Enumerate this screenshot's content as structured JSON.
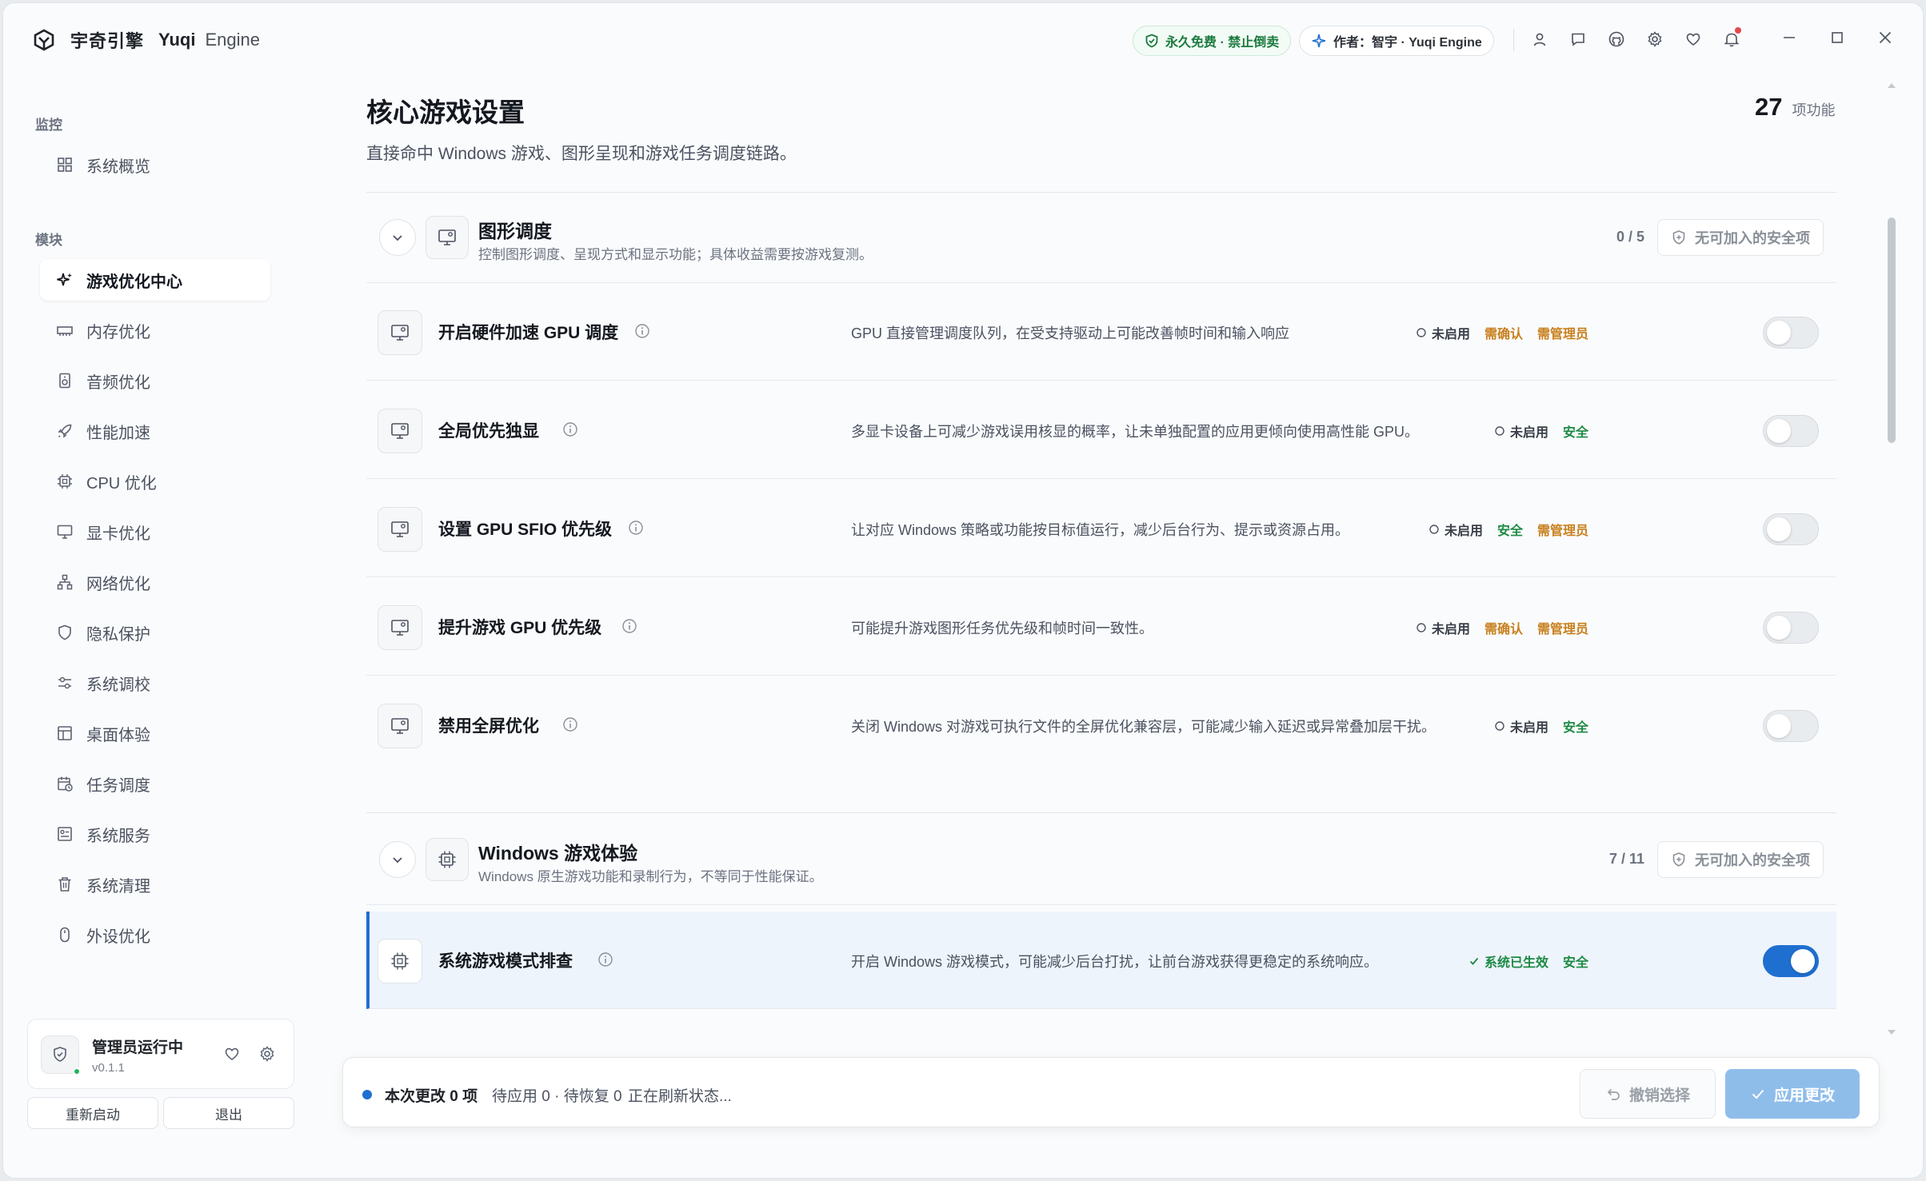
{
  "titlebar": {
    "brand_cn": "宇奇引擎",
    "brand_en": "Yuqi",
    "brand_en2": "Engine",
    "badge_free": "永久免费 · 禁止倒卖",
    "badge_author": "作者：智宇 · Yuqi Engine",
    "icons": [
      "user-icon",
      "chat-icon",
      "github-icon",
      "gear-icon",
      "heart-icon",
      "bell-icon"
    ],
    "window_controls": [
      "minimize-icon",
      "maximize-icon",
      "close-icon"
    ]
  },
  "sidebar": {
    "group_monitor": "监控",
    "group_modules": "模块",
    "items": [
      {
        "label": "系统概览",
        "icon": "grid-icon"
      },
      {
        "label": "游戏优化中心",
        "icon": "sparkle-icon",
        "active": true
      },
      {
        "label": "内存优化",
        "icon": "memory-icon"
      },
      {
        "label": "音频优化",
        "icon": "speaker-icon"
      },
      {
        "label": "性能加速",
        "icon": "rocket-icon"
      },
      {
        "label": "CPU 优化",
        "icon": "cpu-icon"
      },
      {
        "label": "显卡优化",
        "icon": "monitor-icon"
      },
      {
        "label": "网络优化",
        "icon": "network-icon"
      },
      {
        "label": "隐私保护",
        "icon": "shield-icon"
      },
      {
        "label": "系统调校",
        "icon": "sliders-icon"
      },
      {
        "label": "桌面体验",
        "icon": "layout-icon"
      },
      {
        "label": "任务调度",
        "icon": "calendar-clock-icon"
      },
      {
        "label": "系统服务",
        "icon": "services-icon"
      },
      {
        "label": "系统清理",
        "icon": "trash-icon"
      },
      {
        "label": "外设优化",
        "icon": "mouse-icon"
      }
    ],
    "admin": {
      "title": "管理员运行中",
      "version": "v0.1.1"
    },
    "restart_label": "重新启动",
    "exit_label": "退出"
  },
  "main": {
    "title": "核心游戏设置",
    "subtitle": "直接命中 Windows 游戏、图形呈现和游戏任务调度链路。",
    "count_num": "27",
    "count_label": "项功能",
    "sections": [
      {
        "title": "图形调度",
        "desc": "控制图形调度、呈现方式和显示功能；具体收益需要按游戏复测。",
        "count": "0 / 5",
        "safe_label": "无可加入的安全项",
        "rows": [
          {
            "title": "开启硬件加速 GPU 调度",
            "desc": "GPU 直接管理调度队列，在受支持驱动上可能改善帧时间和输入响应",
            "status": "未启用",
            "tags": [
              {
                "text": "需确认",
                "kind": "warn"
              },
              {
                "text": "需管理员",
                "kind": "warn"
              }
            ],
            "on": false
          },
          {
            "title": "全局优先独显",
            "desc": "多显卡设备上可减少游戏误用核显的概率，让未单独配置的应用更倾向使用高性能 GPU。",
            "status": "未启用",
            "tags": [
              {
                "text": "安全",
                "kind": "safe"
              }
            ],
            "on": false
          },
          {
            "title": "设置 GPU SFIO 优先级",
            "desc": "让对应 Windows 策略或功能按目标值运行，减少后台行为、提示或资源占用。",
            "status": "未启用",
            "tags": [
              {
                "text": "安全",
                "kind": "safe"
              },
              {
                "text": "需管理员",
                "kind": "warn"
              }
            ],
            "on": false
          },
          {
            "title": "提升游戏 GPU 优先级",
            "desc": "可能提升游戏图形任务优先级和帧时间一致性。",
            "status": "未启用",
            "tags": [
              {
                "text": "需确认",
                "kind": "warn"
              },
              {
                "text": "需管理员",
                "kind": "warn"
              }
            ],
            "on": false
          },
          {
            "title": "禁用全屏优化",
            "desc": "关闭 Windows 对游戏可执行文件的全屏优化兼容层，可能减少输入延迟或异常叠加层干扰。",
            "status": "未启用",
            "tags": [
              {
                "text": "安全",
                "kind": "safe"
              }
            ],
            "on": false
          }
        ]
      },
      {
        "title": "Windows 游戏体验",
        "desc": "Windows 原生游戏功能和录制行为，不等同于性能保证。",
        "count": "7 / 11",
        "safe_label": "无可加入的安全项",
        "rows": [
          {
            "title": "系统游戏模式排查",
            "desc": "开启 Windows 游戏模式，可能减少后台打扰，让前台游戏获得更稳定的系统响应。",
            "status": "系统已生效",
            "tags": [
              {
                "text": "安全",
                "kind": "safe"
              }
            ],
            "on": true
          }
        ]
      }
    ]
  },
  "bottombar": {
    "changes": "本次更改 0 项",
    "pending": "待应用 0 · 待恢复 0",
    "refresh": "正在刷新状态...",
    "undo_label": "撤销选择",
    "apply_label": "应用更改"
  },
  "colors": {
    "accent": "#1f6fd1",
    "safe": "#1c8a44",
    "warn": "#c8801e",
    "badge_green": "#1c7a3e"
  }
}
